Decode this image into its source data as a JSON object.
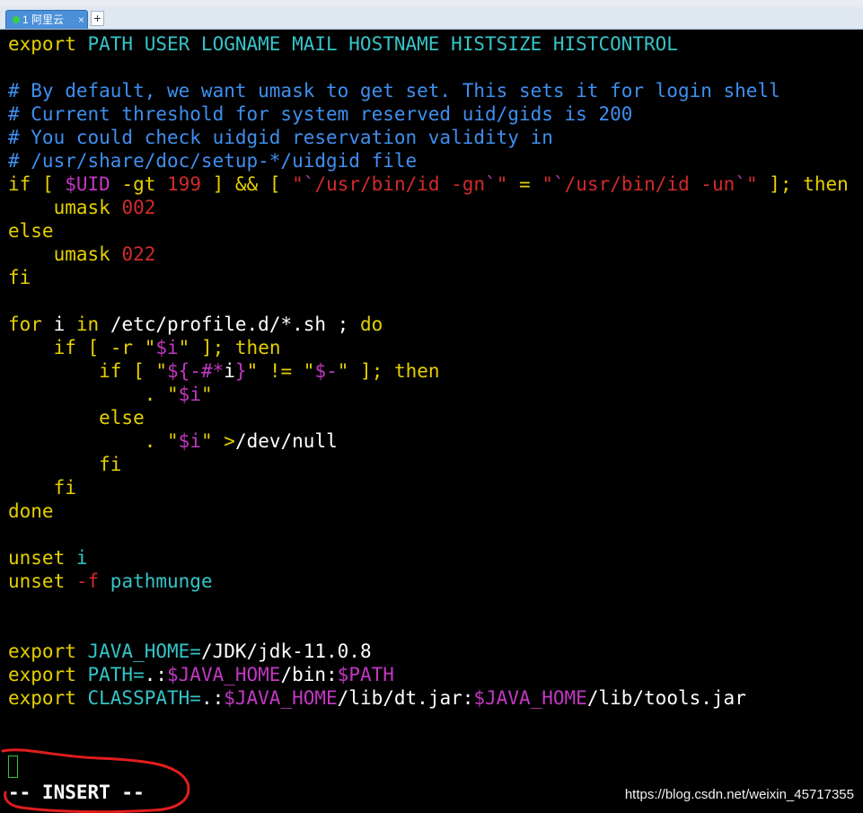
{
  "window": {
    "tab_title": "1 阿里云",
    "tab_close": "×",
    "new_tab": "+"
  },
  "icons": {
    "tab_status": "green-dot-icon",
    "tab_close": "close-icon",
    "new_tab": "plus-icon"
  },
  "colors": {
    "keyword": "#e5d000",
    "variable": "#35c4c8",
    "comment": "#3f8ff0",
    "special": "#c238c2",
    "number": "#d42a2a",
    "text": "#ffffff",
    "annotation": "#e11d1d",
    "tab_active": "#4a8fd8"
  },
  "editor": {
    "lines": [
      [
        [
          "export",
          "yel"
        ],
        [
          " PATH USER LOGNAME MAIL HOSTNAME HISTSIZE HISTCONTROL",
          "cy"
        ]
      ],
      [],
      [
        [
          "# By default, we want umask to get set. This sets it for login shell",
          "bl"
        ]
      ],
      [
        [
          "# Current threshold for system reserved uid/gids is 200",
          "bl"
        ]
      ],
      [
        [
          "# You could check uidgid reservation validity in",
          "bl"
        ]
      ],
      [
        [
          "# /usr/share/doc/setup-*/uidgid file",
          "bl"
        ]
      ],
      [
        [
          "if",
          "yel"
        ],
        [
          " [ ",
          "yel"
        ],
        [
          "$UID",
          "mag"
        ],
        [
          " -gt ",
          "yel"
        ],
        [
          "199",
          "red"
        ],
        [
          " ] && [ ",
          "yel"
        ],
        [
          "\"",
          "red"
        ],
        [
          "`",
          "mag"
        ],
        [
          "/usr/bin/id -gn",
          "red"
        ],
        [
          "`",
          "mag"
        ],
        [
          "\"",
          "red"
        ],
        [
          " = ",
          "yel"
        ],
        [
          "\"",
          "red"
        ],
        [
          "`",
          "mag"
        ],
        [
          "/usr/bin/id -un",
          "red"
        ],
        [
          "`",
          "mag"
        ],
        [
          "\"",
          "red"
        ],
        [
          " ]; ",
          "yel"
        ],
        [
          "then",
          "yel"
        ]
      ],
      [
        [
          "    umask ",
          "yel"
        ],
        [
          "002",
          "red"
        ]
      ],
      [
        [
          "else",
          "yel"
        ]
      ],
      [
        [
          "    umask ",
          "yel"
        ],
        [
          "022",
          "red"
        ]
      ],
      [
        [
          "fi",
          "yel"
        ]
      ],
      [],
      [
        [
          "for",
          "yel"
        ],
        [
          " i ",
          "wh"
        ],
        [
          "in",
          "yel"
        ],
        [
          " /etc/profile.d/*.sh ; ",
          "wh"
        ],
        [
          "do",
          "yel"
        ]
      ],
      [
        [
          "    if",
          "yel"
        ],
        [
          " [ -r ",
          "yel"
        ],
        [
          "\"",
          "yel"
        ],
        [
          "$i",
          "mag"
        ],
        [
          "\"",
          "yel"
        ],
        [
          " ]; ",
          "yel"
        ],
        [
          "then",
          "yel"
        ]
      ],
      [
        [
          "        if",
          "yel"
        ],
        [
          " [ ",
          "yel"
        ],
        [
          "\"",
          "yel"
        ],
        [
          "${-#*",
          "mag"
        ],
        [
          "i",
          "wh"
        ],
        [
          "}",
          "mag"
        ],
        [
          "\"",
          "yel"
        ],
        [
          " != ",
          "yel"
        ],
        [
          "\"",
          "yel"
        ],
        [
          "$-",
          "mag"
        ],
        [
          "\"",
          "yel"
        ],
        [
          " ]; ",
          "yel"
        ],
        [
          "then",
          "yel"
        ]
      ],
      [
        [
          "            . ",
          "yel"
        ],
        [
          "\"",
          "yel"
        ],
        [
          "$i",
          "mag"
        ],
        [
          "\"",
          "yel"
        ]
      ],
      [
        [
          "        else",
          "yel"
        ]
      ],
      [
        [
          "            . ",
          "yel"
        ],
        [
          "\"",
          "yel"
        ],
        [
          "$i",
          "mag"
        ],
        [
          "\"",
          "yel"
        ],
        [
          " ",
          "wh"
        ],
        [
          ">",
          "yel"
        ],
        [
          "/dev/null",
          "wh"
        ]
      ],
      [
        [
          "        fi",
          "yel"
        ]
      ],
      [
        [
          "    fi",
          "yel"
        ]
      ],
      [
        [
          "done",
          "yel"
        ]
      ],
      [],
      [
        [
          "unset",
          "yel"
        ],
        [
          " i",
          "cy"
        ]
      ],
      [
        [
          "unset",
          "yel"
        ],
        [
          " -f",
          "red"
        ],
        [
          " pathmunge",
          "cy"
        ]
      ],
      [],
      [],
      [
        [
          "export",
          "yel"
        ],
        [
          " JAVA_HOME=",
          "cy"
        ],
        [
          "/JDK/jdk-11.0.8",
          "wh"
        ]
      ],
      [
        [
          "export",
          "yel"
        ],
        [
          " PATH=",
          "cy"
        ],
        [
          ".:",
          "wh"
        ],
        [
          "$JAVA_HOME",
          "mag"
        ],
        [
          "/bin:",
          "wh"
        ],
        [
          "$PATH",
          "mag"
        ]
      ],
      [
        [
          "export",
          "yel"
        ],
        [
          " CLASSPATH=",
          "cy"
        ],
        [
          ".:",
          "wh"
        ],
        [
          "$JAVA_HOME",
          "mag"
        ],
        [
          "/lib/dt.jar:",
          "wh"
        ],
        [
          "$JAVA_HOME",
          "mag"
        ],
        [
          "/lib/tools.jar",
          "wh"
        ]
      ]
    ],
    "mode_text": "-- INSERT --",
    "watermark": "https://blog.csdn.net/weixin_45717355"
  }
}
